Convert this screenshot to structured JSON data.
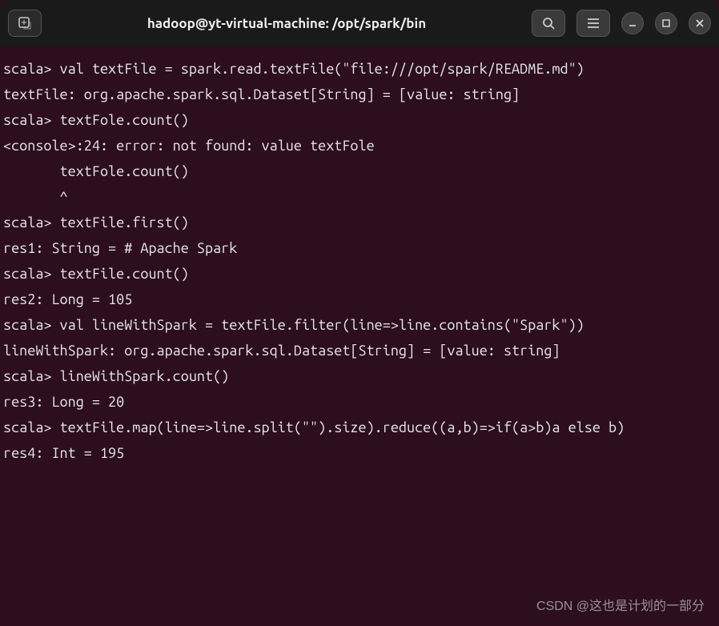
{
  "titlebar": {
    "title": "hadoop@yt-virtual-machine: /opt/spark/bin"
  },
  "terminal": {
    "lines": [
      "scala> val textFile = spark.read.textFile(\"file:///opt/spark/README.md\")",
      "textFile: org.apache.spark.sql.Dataset[String] = [value: string]",
      "",
      "scala> textFole.count()",
      "<console>:24: error: not found: value textFole",
      "       textFole.count()",
      "       ^",
      "",
      "scala> textFile.first()",
      "res1: String = # Apache Spark",
      "",
      "scala> textFile.count()",
      "res2: Long = 105",
      "",
      "scala> val lineWithSpark = textFile.filter(line=>line.contains(\"Spark\"))",
      "lineWithSpark: org.apache.spark.sql.Dataset[String] = [value: string]",
      "",
      "scala> lineWithSpark.count()",
      "res3: Long = 20",
      "",
      "scala> textFile.map(line=>line.split(\"\").size).reduce((a,b)=>if(a>b)a else b)",
      "res4: Int = 195"
    ]
  },
  "watermark": {
    "text": "CSDN @这也是计划的一部分"
  }
}
